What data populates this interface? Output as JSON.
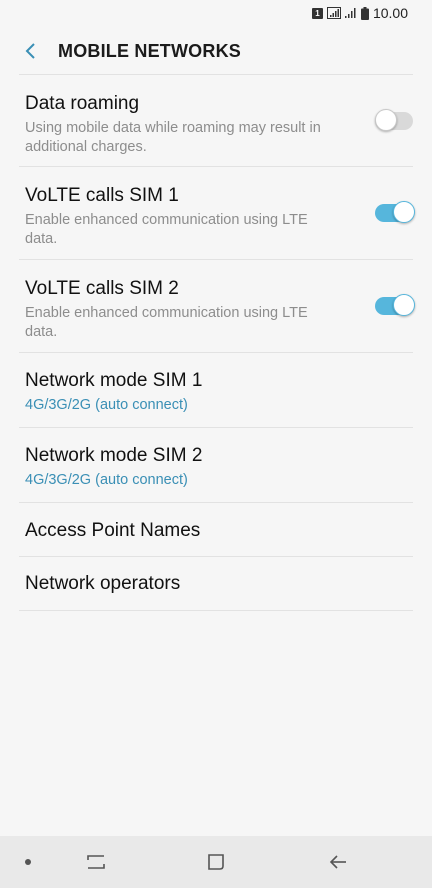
{
  "status_bar": {
    "sim_badge": "1",
    "time": "10.00",
    "icons": [
      "sim-icon",
      "signal-icon",
      "signal-weak-icon",
      "battery-icon"
    ]
  },
  "header": {
    "title": "MOBILE NETWORKS",
    "back_icon": "back-arrow-icon"
  },
  "settings": [
    {
      "title": "Data roaming",
      "subtitle": "Using mobile data while roaming may result in additional charges.",
      "toggle": "off"
    },
    {
      "title": "VoLTE calls SIM 1",
      "subtitle": "Enable enhanced communication using LTE data.",
      "toggle": "on"
    },
    {
      "title": "VoLTE calls SIM 2",
      "subtitle": "Enable enhanced communication using LTE data.",
      "toggle": "on"
    },
    {
      "title": "Network mode SIM 1",
      "value": "4G/3G/2G (auto connect)"
    },
    {
      "title": "Network mode SIM 2",
      "value": "4G/3G/2G (auto connect)"
    },
    {
      "title": "Access Point Names"
    },
    {
      "title": "Network operators"
    }
  ],
  "colors": {
    "accent": "#56b6dc",
    "value_text": "#3a8fb5",
    "background": "#f6f6f6"
  },
  "nav_bar": {
    "icons": [
      "dot-icon",
      "recent-apps-icon",
      "home-icon",
      "back-icon"
    ]
  }
}
